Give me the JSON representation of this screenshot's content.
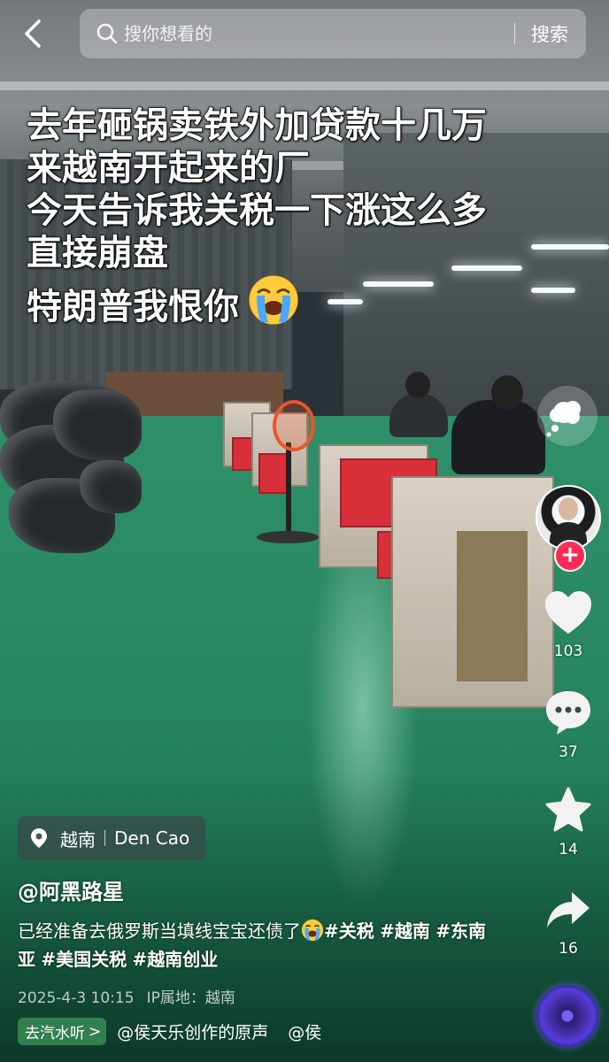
{
  "search": {
    "placeholder": "搜你想看的",
    "button_label": "搜索"
  },
  "caption": {
    "lines": [
      "去年砸锅卖铁外加贷款十几万",
      "来越南开起来的厂",
      "今天告诉我关税一下涨这么多",
      "直接崩盘",
      "特朗普我恨你"
    ],
    "emoji": "crying-face-icon"
  },
  "rail": {
    "like_count": "103",
    "comment_count": "37",
    "favorite_count": "14",
    "share_count": "16"
  },
  "location": {
    "country": "越南",
    "place": "Den Cao"
  },
  "author": "@阿黑路星",
  "description": {
    "text": "已经准备去俄罗斯当填线宝宝还债了",
    "tags": [
      "#关税",
      "#越南",
      "#东南亚",
      "#美国关税",
      "#越南创业"
    ]
  },
  "meta": {
    "date": "2025-4-3 10:15",
    "ip": "IP属地：越南"
  },
  "music": {
    "chip_label": "去汽水听",
    "chip_chevron": ">",
    "title": "@侯天乐创作的原声",
    "author": "@侯"
  },
  "colors": {
    "accent_red": "#fe2c55",
    "floor_green": "#2a8a63"
  }
}
